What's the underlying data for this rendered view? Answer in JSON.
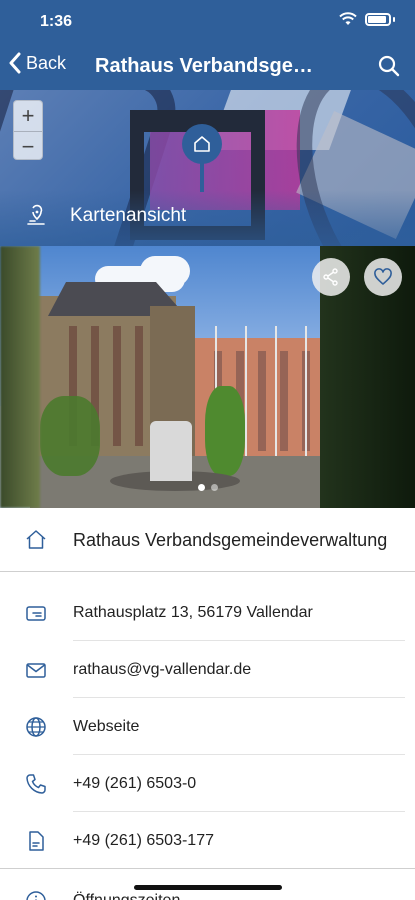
{
  "status": {
    "time": "1:36"
  },
  "nav": {
    "back_label": "Back",
    "title": "Rathaus Verbandsgemeindeverwaltung"
  },
  "map": {
    "zoom_in": "+",
    "zoom_out": "−",
    "label": "Kartenansicht"
  },
  "photo": {
    "slides": 2,
    "active_slide": 1
  },
  "details": {
    "name": "Rathaus Verbandsgemeindeverwaltung",
    "address": "Rathausplatz 13, 56179 Vallendar",
    "email": "rathaus@vg-vallendar.de",
    "website": "Webseite",
    "phone": "+49 (261) 6503-0",
    "fax": "+49 (261) 6503-177",
    "hours": "Öffnungszeiten"
  },
  "colors": {
    "primary": "#2f5f9a",
    "icon": "#2f5f9a"
  }
}
